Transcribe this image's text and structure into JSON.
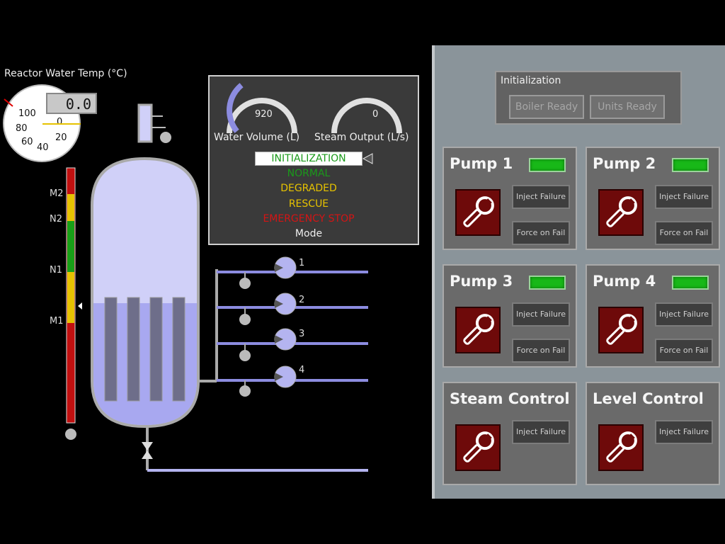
{
  "temperature_gauge": {
    "title": "Reactor Water Temp (°C)",
    "readout": "0.0",
    "ticks": [
      "100",
      "80",
      "60",
      "40",
      "20",
      "0"
    ]
  },
  "level_bar": {
    "labels": [
      "M2",
      "N2",
      "N1",
      "M1"
    ]
  },
  "status_panel": {
    "water_volume": {
      "value": "920",
      "label": "Water Volume (L)",
      "fill_fraction": 0.35
    },
    "steam_output": {
      "value": "0",
      "label": "Steam Output (L/s)",
      "fill_fraction": 0
    },
    "modes": [
      {
        "label": "INITIALIZATION",
        "color": "#1a9a1a",
        "active": true
      },
      {
        "label": "NORMAL",
        "color": "#1a9a1a",
        "active": false
      },
      {
        "label": "DEGRADED",
        "color": "#e6c200",
        "active": false
      },
      {
        "label": "RESCUE",
        "color": "#e6c200",
        "active": false
      },
      {
        "label": "EMERGENCY STOP",
        "color": "#d41414",
        "active": false
      }
    ],
    "mode_caption": "Mode"
  },
  "pumps": {
    "labels": [
      "1",
      "2",
      "3",
      "4"
    ]
  },
  "initialization": {
    "title": "Initialization",
    "boiler_ready": "Boiler Ready",
    "units_ready": "Units Ready"
  },
  "controls": {
    "pump1": {
      "title": "Pump 1",
      "inject": "Inject Failure",
      "force": "Force on Fail"
    },
    "pump2": {
      "title": "Pump 2",
      "inject": "Inject Failure",
      "force": "Force on Fail"
    },
    "pump3": {
      "title": "Pump 3",
      "inject": "Inject Failure",
      "force": "Force on Fail"
    },
    "pump4": {
      "title": "Pump 4",
      "inject": "Inject Failure",
      "force": "Force on Fail"
    },
    "steam": {
      "title": "Steam Control",
      "inject": "Inject Failure"
    },
    "level": {
      "title": "Level Control",
      "inject": "Inject Failure"
    }
  },
  "colors": {
    "accent": "#b4b4ff",
    "led_on": "#18b818",
    "wrench_bg": "#6e0a0a"
  }
}
